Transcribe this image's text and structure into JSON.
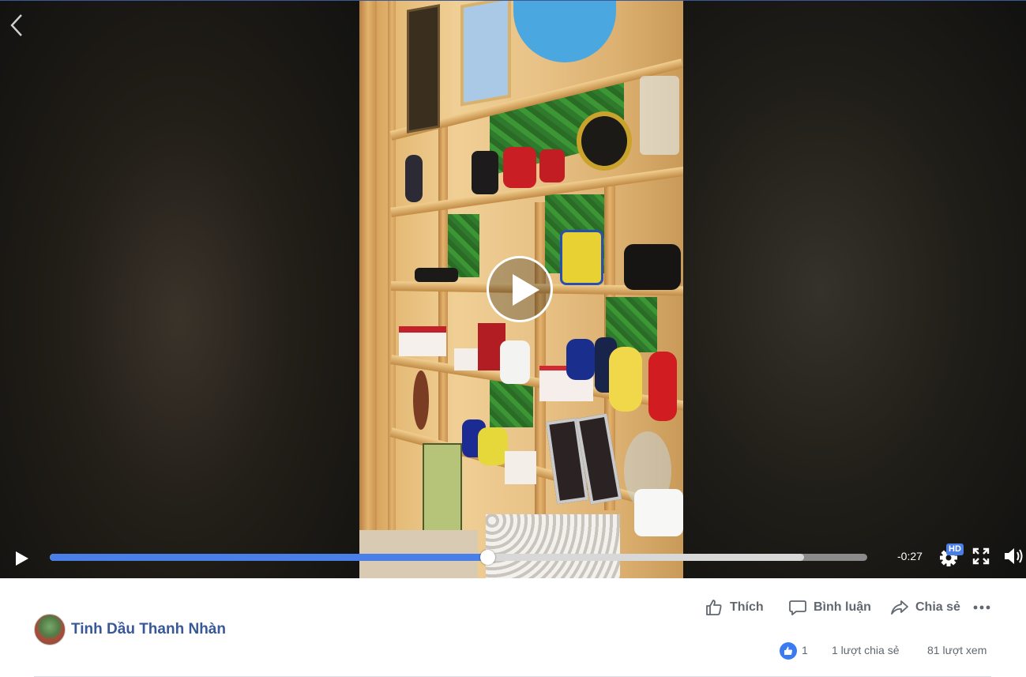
{
  "player": {
    "time_remaining": "-0:27",
    "quality_badge": "HD",
    "progress_fraction": 0.536,
    "buffered_fraction": 0.923,
    "icons": {
      "back": "chevron-left-icon",
      "center_play": "play-circle-icon",
      "play": "play-icon",
      "settings": "gear-icon",
      "fullscreen": "fullscreen-icon",
      "volume": "volume-icon"
    }
  },
  "post": {
    "author_name": "Tinh Dầu Thanh Nhàn",
    "actions": {
      "like_label": "Thích",
      "comment_label": "Bình luận",
      "share_label": "Chia sẻ"
    },
    "stats": {
      "like_count": "1",
      "shares": "1 lượt chia sẻ",
      "views": "81 lượt xem"
    }
  },
  "colors": {
    "accent_blue": "#4a7fe8",
    "author_link": "#385898",
    "action_gray": "#606770"
  }
}
